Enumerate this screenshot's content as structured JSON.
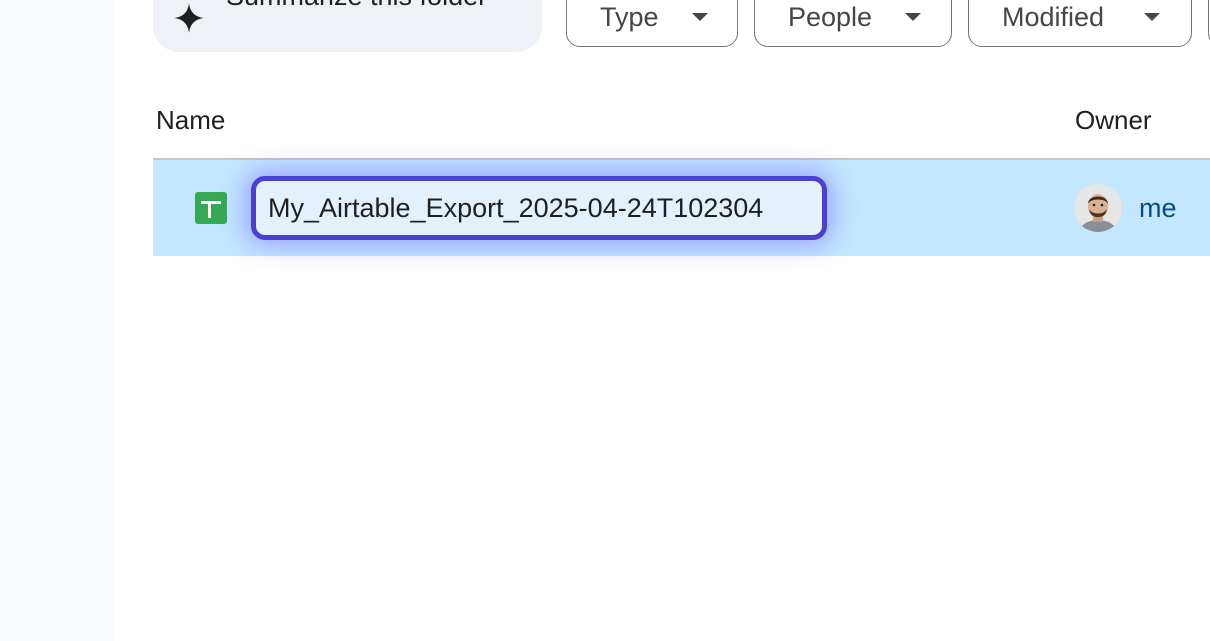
{
  "toolbar": {
    "summarize_label": "Summarize this folder",
    "filters": [
      {
        "label": "Type"
      },
      {
        "label": "People"
      },
      {
        "label": "Modified"
      }
    ]
  },
  "table": {
    "columns": {
      "name": "Name",
      "owner": "Owner"
    },
    "rows": [
      {
        "name": "My_Airtable_Export_2025-04-24T102304",
        "owner": "me",
        "file_icon": "google-sheets-icon",
        "selected": true,
        "renaming": true
      }
    ]
  },
  "colors": {
    "selected_row": "#c2e7ff",
    "rename_border": "#4b3fd4",
    "sheets_green": "#34a853"
  }
}
